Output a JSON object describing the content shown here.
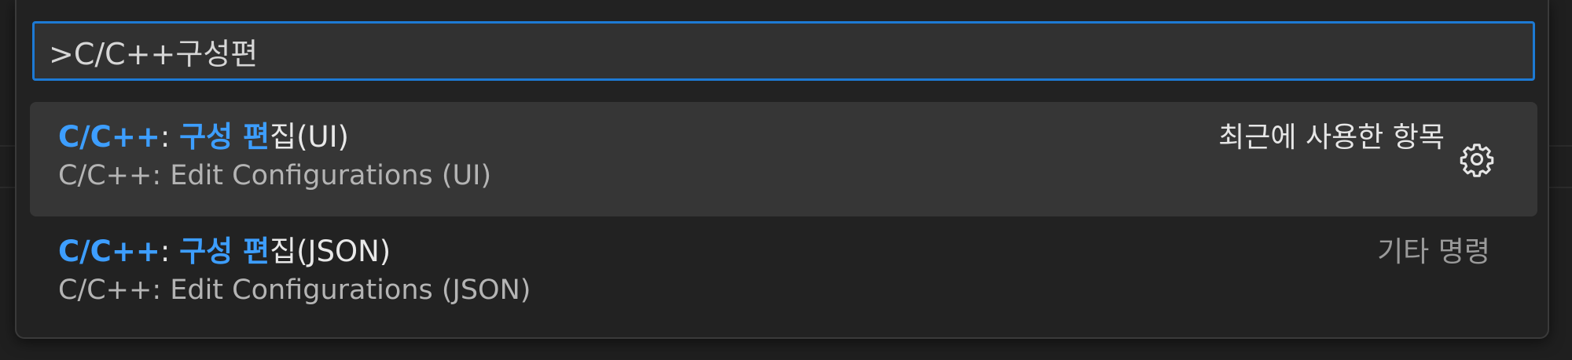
{
  "search": {
    "value": ">C/C++구성편"
  },
  "results": [
    {
      "title_highlight_1": "C/C++",
      "title_sep": ": ",
      "title_highlight_2": "구성 편",
      "title_rest": "집(UI)",
      "subtitle": "C/C++: Edit Configurations (UI)",
      "tag": "최근에 사용한 항목",
      "icon": "gear-icon"
    },
    {
      "title_highlight_1": "C/C++",
      "title_sep": ": ",
      "title_highlight_2": "구성 편",
      "title_rest": "집(JSON)",
      "subtitle": "C/C++: Edit Configurations (JSON)",
      "tag": "기타 명령"
    }
  ],
  "colors": {
    "accent": "#1d7ad4",
    "highlight": "#3d9eff"
  }
}
